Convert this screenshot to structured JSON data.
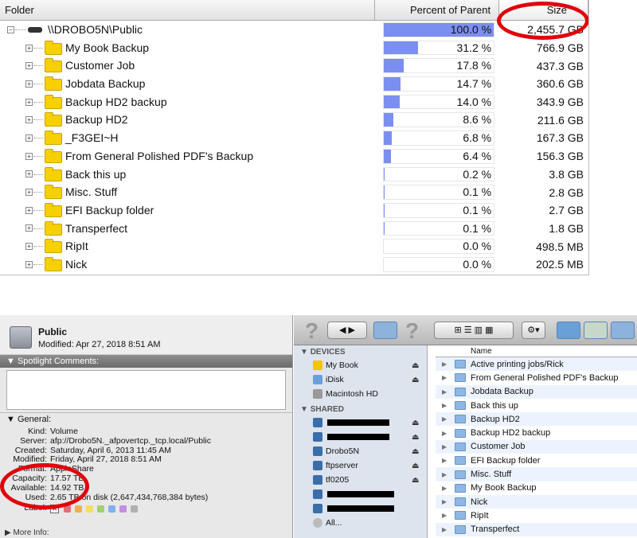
{
  "tree": {
    "headers": {
      "folder": "Folder",
      "percent": "Percent of Parent",
      "size": "Size"
    },
    "root": {
      "name": "\\\\DROBO5N\\Public",
      "percent_label": "100.0 %",
      "fraction": 1.0,
      "size": "2,455.7 GB"
    },
    "rows": [
      {
        "name": "My Book Backup",
        "percent_label": "31.2 %",
        "fraction": 0.312,
        "size": "766.9 GB"
      },
      {
        "name": "Customer Job",
        "percent_label": "17.8 %",
        "fraction": 0.178,
        "size": "437.3 GB"
      },
      {
        "name": " Jobdata Backup",
        "percent_label": "14.7 %",
        "fraction": 0.147,
        "size": "360.6 GB"
      },
      {
        "name": "Backup HD2 backup",
        "percent_label": "14.0 %",
        "fraction": 0.14,
        "size": "343.9 GB"
      },
      {
        "name": "Backup HD2",
        "percent_label": "8.6 %",
        "fraction": 0.086,
        "size": "211.6 GB"
      },
      {
        "name": "_F3GEI~H",
        "percent_label": "6.8 %",
        "fraction": 0.068,
        "size": "167.3 GB"
      },
      {
        "name": " From General Polished PDF's Backup",
        "percent_label": "6.4 %",
        "fraction": 0.064,
        "size": "156.3 GB"
      },
      {
        "name": "Back this up",
        "percent_label": "0.2 %",
        "fraction": 0.002,
        "size": "3.8 GB"
      },
      {
        "name": "Misc. Stuff",
        "percent_label": "0.1 %",
        "fraction": 0.001,
        "size": "2.8 GB"
      },
      {
        "name": "EFI Backup folder",
        "percent_label": "0.1 %",
        "fraction": 0.001,
        "size": "2.7 GB"
      },
      {
        "name": "Transperfect",
        "percent_label": "0.1 %",
        "fraction": 0.001,
        "size": "1.8 GB"
      },
      {
        "name": "RipIt",
        "percent_label": "0.0 %",
        "fraction": 0.0,
        "size": "498.5 MB"
      },
      {
        "name": "Nick",
        "percent_label": "0.0 %",
        "fraction": 0.0,
        "size": "202.5 MB"
      }
    ]
  },
  "info": {
    "name": "Public",
    "modified": "Modified: Apr 27, 2018 8:51 AM",
    "spotlight": "Spotlight Comments:",
    "general": "General:",
    "fields": [
      {
        "k": "Kind:",
        "v": "Volume"
      },
      {
        "k": "Server:",
        "v": "afp://Drobo5N._afpovertcp._tcp.local/Public"
      },
      {
        "k": "Created:",
        "v": "Saturday, April 6, 2013 11:45 AM"
      },
      {
        "k": "Modified:",
        "v": "Friday, April 27, 2018 8:51 AM"
      },
      {
        "k": "Format:",
        "v": "AppleShare"
      },
      {
        "k": "Capacity:",
        "v": "17.57 TB"
      },
      {
        "k": "Available:",
        "v": "14.92 TB"
      },
      {
        "k": "Used:",
        "v": "2.65 TB on disk (2,647,434,768,384 bytes)"
      }
    ],
    "label": "Label:",
    "more": "More Info:",
    "label_colors": [
      "#e07070",
      "#f0b050",
      "#f0e060",
      "#a0d070",
      "#80b0f0",
      "#c090e0",
      "#b0b0b0"
    ]
  },
  "sidebar": {
    "devices": "DEVICES",
    "device_items": [
      "My Book",
      "iDisk",
      "Macintosh HD"
    ],
    "shared": "SHARED",
    "shared_items": [
      "",
      "",
      "Drobo5N",
      "ftpserver",
      "tf0205",
      "",
      "",
      "All..."
    ]
  },
  "list": {
    "header": "Name",
    "items": [
      "Active printing jobs/Rick",
      "From General Polished PDF's Backup",
      "Jobdata Backup",
      "Back this up",
      "Backup HD2",
      "Backup HD2 backup",
      "Customer Job",
      "EFI Backup folder",
      "Misc. Stuff",
      "My Book Backup",
      "Nick",
      "RipIt",
      "Transperfect"
    ]
  },
  "accent": "#7b8ff0",
  "highlight": "#e0000a"
}
